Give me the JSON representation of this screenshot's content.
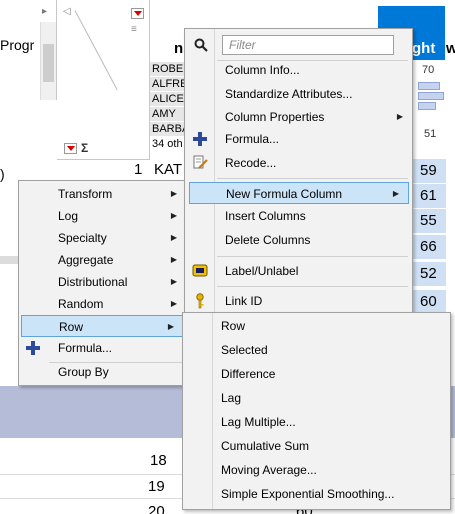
{
  "background": {
    "left_panel_text": "Progr",
    "column_header_name": "n",
    "column_header_ght": "ght",
    "column_header_w": "w",
    "name_values": [
      "ROBE",
      "ALFRE",
      "ALICE",
      "AMY",
      "BARBA"
    ],
    "name_others": "34 oth",
    "hist_top": "70",
    "hist_bottom": "51",
    "first_row_number": "1",
    "first_row_name": "KAT",
    "height_values": [
      "59",
      "61",
      "55",
      "66",
      "52",
      "60"
    ],
    "strip_text": ")",
    "bottom_rows": [
      "18",
      "19",
      "20"
    ],
    "bottom_values": [
      "60"
    ]
  },
  "main_menu": {
    "filter_placeholder": "Filter",
    "items": {
      "column_info": "Column Info...",
      "standardize": "Standardize Attributes...",
      "column_properties": "Column Properties",
      "formula": "Formula...",
      "recode": "Recode...",
      "new_formula_column": "New Formula Column",
      "insert_columns": "Insert Columns",
      "delete_columns": "Delete Columns",
      "label_unlabel": "Label/Unlabel",
      "link_id": "Link ID"
    }
  },
  "formula_submenu": {
    "items": {
      "transform": "Transform",
      "log": "Log",
      "specialty": "Specialty",
      "aggregate": "Aggregate",
      "distributional": "Distributional",
      "random": "Random",
      "row": "Row",
      "formula": "Formula...",
      "group_by": "Group By"
    }
  },
  "row_submenu": {
    "items": [
      "Row",
      "Selected",
      "Difference",
      "Lag",
      "Lag Multiple...",
      "Cumulative Sum",
      "Moving Average...",
      "Simple Exponential Smoothing..."
    ]
  },
  "colors": {
    "header_selected": "#0078d7",
    "highlight_bg": "#cce4f7",
    "highlight_border": "#5fa4dc",
    "value_cell": "#cfe0f5",
    "band": "#b4bcd8"
  },
  "icons": [
    "search-icon",
    "plus-icon",
    "recode-icon",
    "label-tag-icon",
    "key-icon",
    "red-triangle-icon",
    "sigma-icon"
  ]
}
